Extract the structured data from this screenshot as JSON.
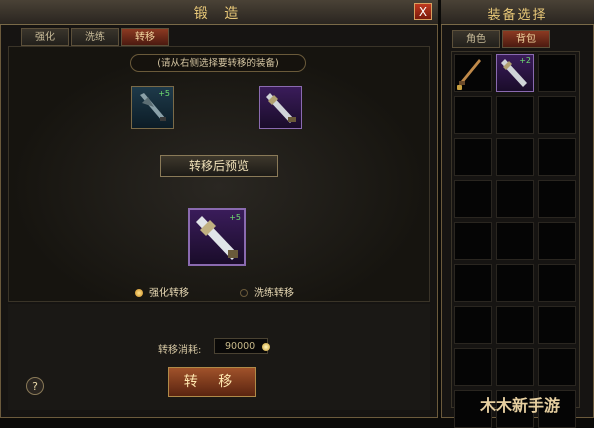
{
  "forge_panel": {
    "title": "锻 造",
    "close_label": "X",
    "tabs": [
      {
        "label": "强化"
      },
      {
        "label": "洗练"
      },
      {
        "label": "转移"
      }
    ],
    "active_tab_index": 2,
    "hint": "(请从右侧选择要转移的装备)",
    "source_item": {
      "plus": "+5",
      "icon": "sword-icon"
    },
    "target_item": {
      "icon": "sword-icon"
    },
    "preview_label": "转移后预览",
    "preview_item": {
      "plus": "+5",
      "icon": "sword-icon"
    },
    "options": [
      {
        "label": "强化转移",
        "selected": true
      },
      {
        "label": "洗练转移",
        "selected": false
      }
    ],
    "cost_label": "转移消耗:",
    "cost_value": "90000",
    "transfer_button": "转 移",
    "help_label": "?"
  },
  "equip_panel": {
    "title": "装备选择",
    "tabs": [
      {
        "label": "角色"
      },
      {
        "label": "背包"
      }
    ],
    "active_tab_index": 1,
    "items": [
      {
        "slot": 0,
        "icon": "sword-icon",
        "locked": true
      },
      {
        "slot": 1,
        "icon": "sword-icon",
        "plus": "+2"
      }
    ]
  },
  "watermark": "木木新手游",
  "colors": {
    "accent": "#e8c878",
    "active_tab": "#8c3a22",
    "plus_text": "#6fe06f"
  }
}
